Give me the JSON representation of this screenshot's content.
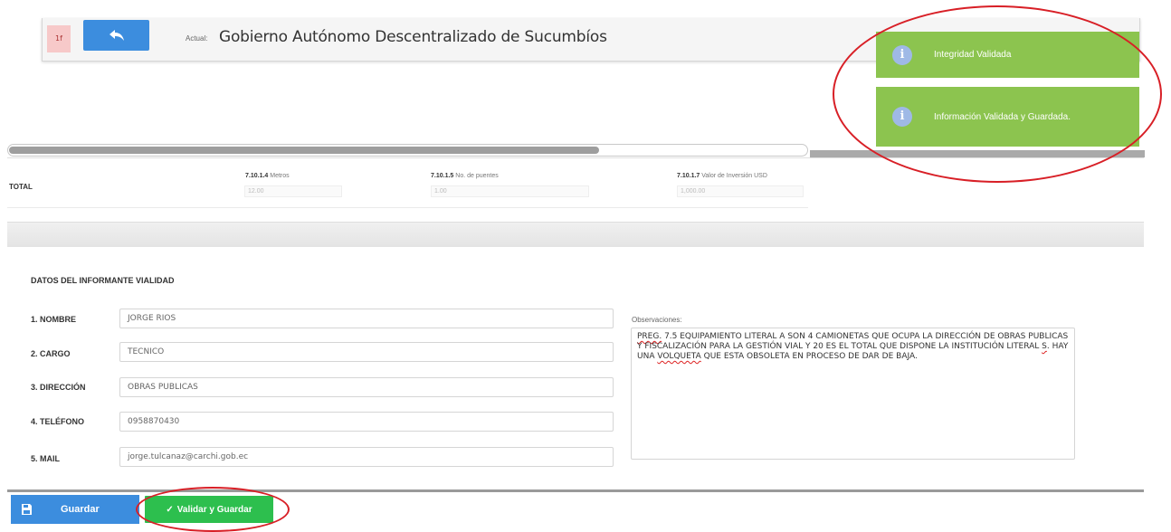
{
  "header": {
    "step_badge": "1f",
    "actual_label": "Actual:",
    "entity_title": "Gobierno Autónomo Descentralizado de Sucumbíos"
  },
  "totals_row": {
    "total_label": "TOTAL",
    "columns": [
      {
        "code": "7.10.1.4",
        "name": "Metros",
        "value": "12.00"
      },
      {
        "code": "7.10.1.5",
        "name": "No. de puentes",
        "value": "1.00"
      },
      {
        "code": "7.10.1.7",
        "name": "Valor de Inversión USD",
        "value": "1,000.00"
      }
    ]
  },
  "informant": {
    "section_title": "DATOS DEL INFORMANTE VIALIDAD",
    "fields": [
      {
        "label": "1. NOMBRE",
        "value": "JORGE RIOS"
      },
      {
        "label": "2. CARGO",
        "value": "TECNICO"
      },
      {
        "label": "3. DIRECCIÓN",
        "value": "OBRAS PUBLICAS"
      },
      {
        "label": "4. TELÉFONO",
        "value": "0958870430"
      },
      {
        "label": "5. MAIL",
        "value": "jorge.tulcanaz@carchi.gob.ec"
      }
    ],
    "observations_label": "Observaciones:",
    "observations": {
      "w1": "PREG.",
      "t1": " 7.5 EQUIPAMIENTO LITERAL A SON 4 CAMIONETAS QUE OCUPA LA DIRECCIÓN DE OBRAS PUBLICAS Y FISCALIZACIÓN PARA LA GESTIÓN VIAL Y 20 ES EL TOTAL QUE DISPONE LA INSTITUCIÓN LITERAL ",
      "w2": "S",
      "t2": ". HAY UNA ",
      "w3": "VOLQUETA",
      "t3": " QUE ESTA OBSOLETA EN PROCESO DE DAR DE BAJA."
    }
  },
  "actions": {
    "save_label": "Guardar",
    "validate_label": "Validar y Guardar"
  },
  "notifications": [
    {
      "message": "Integridad Validada"
    },
    {
      "message": "Información Validada y Guardada."
    }
  ],
  "colors": {
    "primary_blue": "#3c8dde",
    "success_green": "#2dbf4e",
    "toast_green": "#8cc44f",
    "annotation_red": "#d81f26"
  }
}
